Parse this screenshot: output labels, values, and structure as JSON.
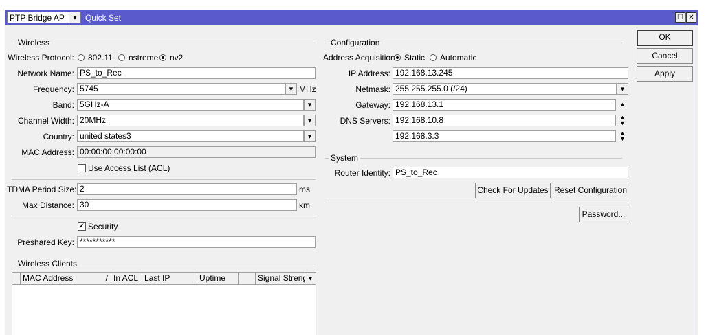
{
  "header": {
    "preset": "PTP Bridge AP",
    "title": "Quick Set"
  },
  "actions": {
    "ok": "OK",
    "cancel": "Cancel",
    "apply": "Apply"
  },
  "wireless": {
    "group_label": "Wireless",
    "protocol_label": "Wireless Protocol:",
    "protocols": [
      "802.11",
      "nstreme",
      "nv2"
    ],
    "protocol_selected": "nv2",
    "network_name_label": "Network Name:",
    "network_name": "PS_to_Rec",
    "frequency_label": "Frequency:",
    "frequency": "5745",
    "frequency_unit": "MHz",
    "band_label": "Band:",
    "band": "5GHz-A",
    "channel_width_label": "Channel Width:",
    "channel_width": "20MHz",
    "country_label": "Country:",
    "country": "united states3",
    "mac_label": "MAC Address:",
    "mac": "00:00:00:00:00:00",
    "acl_label": "Use Access List (ACL)",
    "tdma_label": "TDMA Period Size:",
    "tdma": "2",
    "tdma_unit": "ms",
    "max_distance_label": "Max Distance:",
    "max_distance": "30",
    "max_distance_unit": "km",
    "security_label": "Security",
    "preshared_label": "Preshared Key:",
    "preshared": "***********"
  },
  "clients": {
    "group_label": "Wireless Clients",
    "columns": [
      "MAC Address",
      "In ACL",
      "Last IP",
      "Uptime",
      "",
      "Signal Strength"
    ],
    "sort_mark": "/"
  },
  "configuration": {
    "group_label": "Configuration",
    "acq_label": "Address Acquisition:",
    "acq_options": [
      "Static",
      "Automatic"
    ],
    "acq_selected": "Static",
    "ip_label": "IP Address:",
    "ip": "192.168.13.245",
    "netmask_label": "Netmask:",
    "netmask": "255.255.255.0 (/24)",
    "gateway_label": "Gateway:",
    "gateway": "192.168.13.1",
    "dns_label": "DNS Servers:",
    "dns": [
      "192.168.10.8",
      "192.168.3.3"
    ]
  },
  "system": {
    "group_label": "System",
    "identity_label": "Router Identity:",
    "identity": "PS_to_Rec",
    "check_updates": "Check For Updates",
    "reset_config": "Reset Configuration",
    "password": "Password..."
  }
}
